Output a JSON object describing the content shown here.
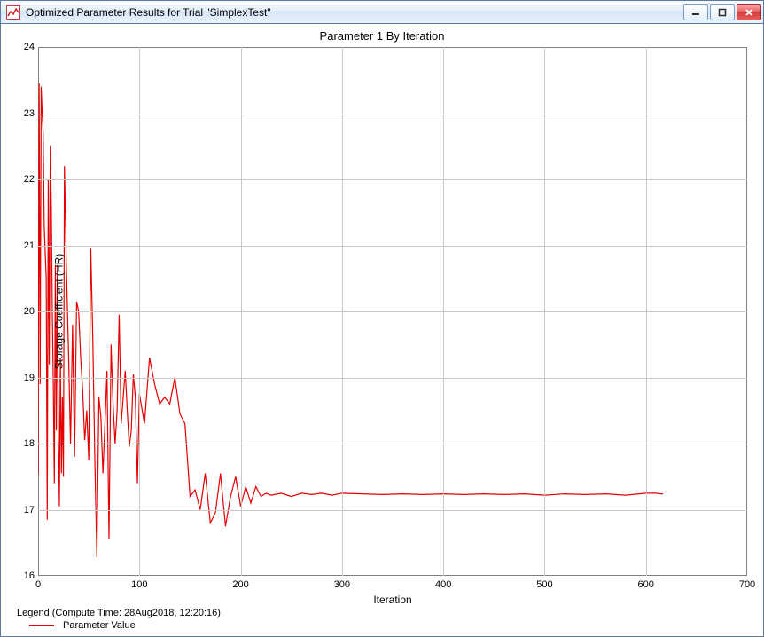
{
  "window": {
    "title": "Optimized Parameter Results for Trial \"SimplexTest\"",
    "icon": "chart-app-icon"
  },
  "chart_data": {
    "type": "line",
    "title": "Parameter 1 By Iteration",
    "xlabel": "Iteration",
    "ylabel": "Storage Coefficient (HR)",
    "xlim": [
      0,
      700
    ],
    "ylim": [
      16,
      24
    ],
    "xticks": [
      0,
      100,
      200,
      300,
      400,
      500,
      600,
      700
    ],
    "yticks": [
      16,
      17,
      18,
      19,
      20,
      21,
      22,
      23,
      24
    ],
    "series": [
      {
        "name": "Parameter Value",
        "color": "#e40000",
        "x": [
          0,
          1,
          2,
          3,
          4,
          5,
          6,
          7,
          8,
          9,
          10,
          11,
          12,
          13,
          14,
          15,
          16,
          17,
          18,
          19,
          20,
          21,
          22,
          23,
          24,
          25,
          26,
          28,
          30,
          32,
          34,
          36,
          38,
          40,
          42,
          44,
          46,
          48,
          50,
          52,
          54,
          56,
          58,
          60,
          62,
          64,
          66,
          68,
          70,
          72,
          74,
          76,
          78,
          80,
          82,
          84,
          86,
          88,
          90,
          92,
          94,
          96,
          98,
          100,
          105,
          110,
          115,
          120,
          125,
          130,
          135,
          140,
          145,
          150,
          155,
          160,
          165,
          170,
          175,
          180,
          185,
          190,
          195,
          200,
          205,
          210,
          215,
          220,
          225,
          230,
          240,
          250,
          260,
          270,
          280,
          290,
          300,
          320,
          340,
          360,
          380,
          400,
          420,
          440,
          460,
          480,
          500,
          520,
          540,
          560,
          580,
          600,
          610,
          615,
          617
        ],
        "y": [
          17.55,
          23.45,
          18.9,
          23.4,
          23.0,
          22.7,
          21.3,
          20.9,
          20.5,
          16.85,
          22.0,
          19.2,
          22.5,
          21.6,
          20.0,
          18.9,
          17.4,
          20.7,
          18.2,
          20.7,
          18.1,
          17.05,
          19.3,
          17.55,
          18.7,
          17.5,
          22.2,
          20.6,
          19.4,
          18.0,
          19.8,
          17.8,
          20.15,
          20.0,
          19.3,
          18.8,
          18.05,
          18.5,
          17.75,
          20.95,
          19.6,
          17.75,
          16.28,
          18.7,
          18.4,
          17.55,
          18.3,
          19.1,
          16.55,
          19.5,
          18.6,
          18.0,
          18.5,
          19.95,
          18.3,
          18.7,
          19.1,
          18.5,
          17.95,
          18.2,
          19.05,
          18.7,
          17.4,
          18.75,
          18.3,
          19.3,
          18.9,
          18.6,
          18.7,
          18.6,
          19.0,
          18.45,
          18.3,
          17.2,
          17.3,
          17.0,
          17.55,
          16.8,
          16.95,
          17.55,
          16.75,
          17.2,
          17.5,
          17.05,
          17.35,
          17.1,
          17.35,
          17.2,
          17.25,
          17.22,
          17.25,
          17.2,
          17.25,
          17.23,
          17.25,
          17.22,
          17.25,
          17.24,
          17.23,
          17.24,
          17.23,
          17.24,
          17.23,
          17.24,
          17.23,
          17.24,
          17.22,
          17.24,
          17.23,
          17.24,
          17.22,
          17.25,
          17.25,
          17.24,
          17.24
        ]
      }
    ]
  },
  "legend": {
    "title": "Legend (Compute Time: 28Aug2018, 12:20:16)",
    "items": [
      "Parameter Value"
    ]
  }
}
